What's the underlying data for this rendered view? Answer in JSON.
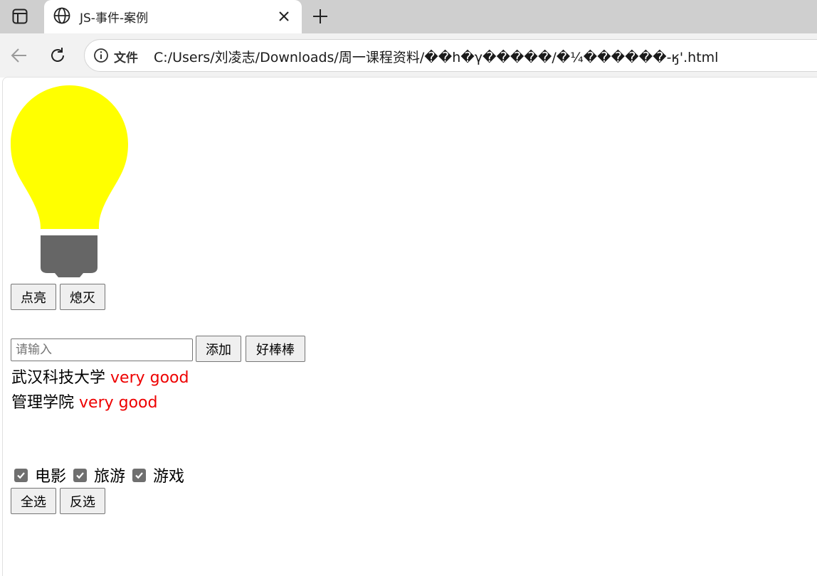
{
  "browser": {
    "tab_title": "JS-事件-案例",
    "site_info_label": "文件",
    "url": "C:/Users/刘凌志/Downloads/周一课程资料/��h�γ�����/�¼������-ӄ'.html"
  },
  "bulb": {
    "state": "on",
    "glass_color": "#ffff00",
    "base_color": "#666666"
  },
  "light_buttons": {
    "on_label": "点亮",
    "off_label": "熄灭"
  },
  "add_form": {
    "input_placeholder": "请输入",
    "input_value": "",
    "add_label": "添加",
    "praise_label": "好棒棒"
  },
  "results": [
    {
      "text": "武汉科技大学",
      "suffix": "very good"
    },
    {
      "text": "管理学院",
      "suffix": "very good"
    }
  ],
  "hobbies": [
    {
      "label": "电影",
      "checked": true
    },
    {
      "label": "旅游",
      "checked": true
    },
    {
      "label": "游戏",
      "checked": true
    }
  ],
  "select_buttons": {
    "select_all_label": "全选",
    "invert_label": "反选"
  },
  "colors": {
    "accent_text": "#ee0000",
    "checkbox": "#6f6f6f"
  }
}
